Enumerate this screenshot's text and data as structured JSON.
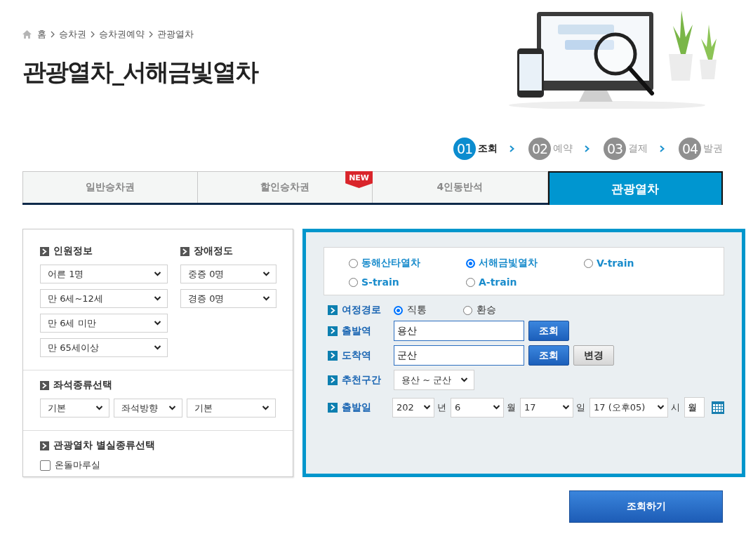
{
  "breadcrumb": [
    "홈",
    "승차권",
    "승차권예약",
    "관광열차"
  ],
  "title": "관광열차_서해금빛열차",
  "steps": [
    {
      "num": "01",
      "label": "조회",
      "selected": true
    },
    {
      "num": "02",
      "label": "예약",
      "selected": false
    },
    {
      "num": "03",
      "label": "결제",
      "selected": false
    },
    {
      "num": "04",
      "label": "발권",
      "selected": false
    }
  ],
  "tabs": [
    {
      "label": "일반승차권",
      "selected": false
    },
    {
      "label": "할인승차권",
      "selected": false,
      "badge": "NEW"
    },
    {
      "label": "4인동반석",
      "selected": false
    },
    {
      "label": "관광열차",
      "selected": true
    }
  ],
  "passengers": {
    "heading": "인원정보",
    "selects": [
      "어른 1명",
      "만 6세~12세",
      "만 6세 미만",
      "만 65세이상"
    ]
  },
  "disability": {
    "heading": "장애정도",
    "selects": [
      "중증 0명",
      "경증 0명"
    ]
  },
  "seat_type": {
    "heading": "좌석종류선택",
    "selects": [
      "기본",
      "좌석방향",
      "기본"
    ]
  },
  "room_type": {
    "heading": "관광열차 별실종류선택",
    "options": [
      {
        "label": "온돌마루실",
        "checked": false
      }
    ]
  },
  "trains": [
    {
      "label": "동해산타열차",
      "selected": false
    },
    {
      "label": "서해금빛열차",
      "selected": true
    },
    {
      "label": "V-train",
      "selected": false
    },
    {
      "label": "S-train",
      "selected": false
    },
    {
      "label": "A-train",
      "selected": false
    }
  ],
  "route": {
    "label": "여정경로",
    "options": [
      {
        "label": "직통",
        "selected": true
      },
      {
        "label": "환승",
        "selected": false
      }
    ]
  },
  "departure": {
    "label": "출발역",
    "value": "용산",
    "buttons": [
      {
        "label": "조회",
        "kind": "primary"
      }
    ]
  },
  "arrival": {
    "label": "도착역",
    "value": "군산",
    "buttons": [
      {
        "label": "조회",
        "kind": "primary"
      },
      {
        "label": "변경",
        "kind": "secondary"
      }
    ]
  },
  "recommended": {
    "label": "추천구간",
    "select": "용산 ~ 군산"
  },
  "date": {
    "label": "출발일",
    "parts": [
      {
        "value": "202",
        "unit": "년"
      },
      {
        "value": "6",
        "unit": "월"
      },
      {
        "value": "17",
        "unit": "일"
      },
      {
        "value": "17 (오후05)",
        "unit": "시"
      }
    ],
    "field": "월"
  },
  "search_button": "조회하기"
}
